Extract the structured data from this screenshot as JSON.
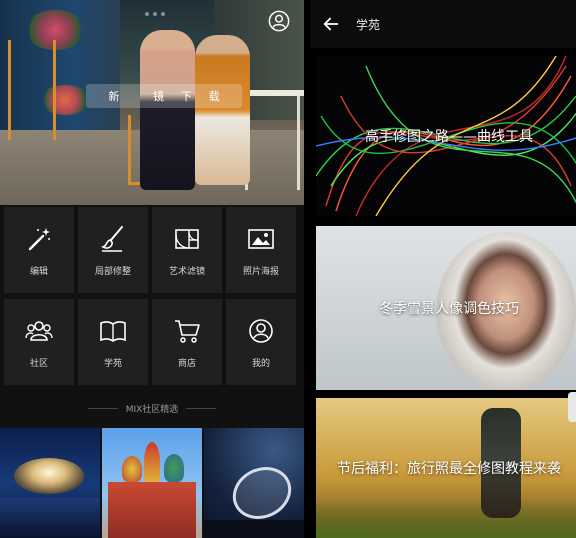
{
  "left_screen": {
    "hero": {
      "search_chars": [
        "新",
        "",
        "镜",
        "下",
        "载"
      ]
    },
    "features": [
      {
        "label": "编辑",
        "icon": "magic-wand-icon"
      },
      {
        "label": "局部修整",
        "icon": "brush-icon"
      },
      {
        "label": "艺术滤镜",
        "icon": "golden-ratio-icon"
      },
      {
        "label": "照片海报",
        "icon": "poster-icon"
      },
      {
        "label": "社区",
        "icon": "community-icon"
      },
      {
        "label": "学苑",
        "icon": "book-icon"
      },
      {
        "label": "商店",
        "icon": "cart-icon"
      },
      {
        "label": "我的",
        "icon": "profile-icon"
      }
    ],
    "section_title": "MIX社区精选",
    "photos": [
      "photo-1",
      "photo-2",
      "photo-3"
    ]
  },
  "right_screen": {
    "topbar": {
      "title": "学苑",
      "back_icon": "back-arrow-icon"
    },
    "cards": [
      {
        "title": "高手修图之路——曲线工具"
      },
      {
        "title": "冬季雪景人像调色技巧"
      },
      {
        "title": "节后福利：旅行照最全修图教程来袭"
      }
    ]
  },
  "colors": {
    "background": "#000000",
    "tile": "#202020",
    "text": "#d6d6d6"
  }
}
